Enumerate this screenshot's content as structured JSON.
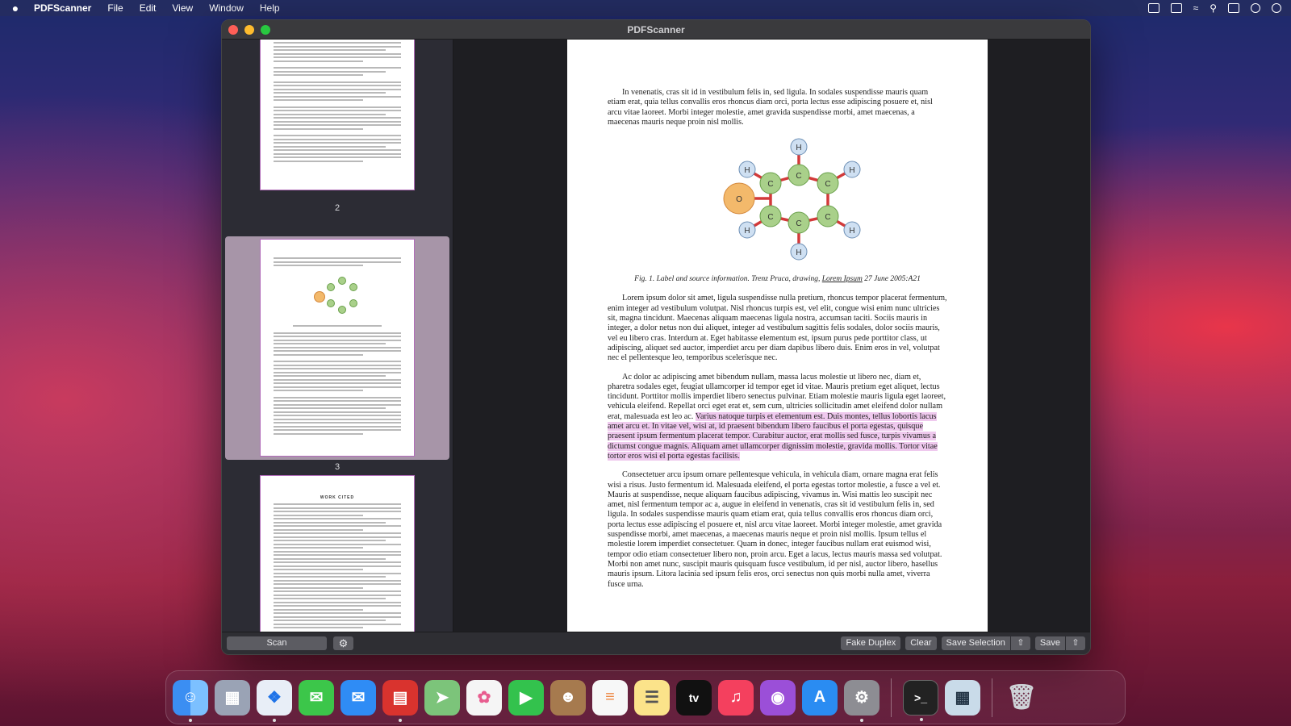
{
  "menubar": {
    "app": "PDFScanner",
    "items": [
      "File",
      "Edit",
      "View",
      "Window",
      "Help"
    ]
  },
  "window": {
    "title": "PDFScanner"
  },
  "sidebar": {
    "thumbnails": [
      {
        "page": "2",
        "selected": false
      },
      {
        "page": "3",
        "selected": true
      },
      {
        "page": "",
        "selected": false,
        "heading": "WORK CITED"
      }
    ]
  },
  "document": {
    "para1": "In venenatis, cras sit id in vestibulum felis in, sed ligula. In sodales suspendisse mauris quam etiam erat, quia tellus convallis eros rhoncus diam orci, porta lectus esse adipiscing posuere et, nisl arcu vitae laoreet. Morbi integer molestie, amet gravida suspendisse morbi, amet maecenas, a maecenas mauris neque proin nisl mollis.",
    "caption_before": "Fig. 1. Label and source information. Trenz Pruca, drawing, ",
    "caption_link": "Lorem Ipsum",
    "caption_after": " 27 June 2005:A21",
    "para2": "Lorem ipsum dolor sit amet, ligula suspendisse nulla pretium, rhoncus tempor placerat fermentum, enim integer ad vestibulum volutpat. Nisl rhoncus turpis est, vel elit, congue wisi enim nunc ultricies sit, magna tincidunt. Maecenas aliquam maecenas ligula nostra, accumsan taciti. Sociis mauris in integer, a dolor netus non dui aliquet, integer ad vestibulum sagittis felis sodales, dolor sociis mauris, vel eu libero cras. Interdum at. Eget habitasse elementum est, ipsum purus pede porttitor class, ut adipiscing, aliquet sed auctor, imperdiet arcu per diam dapibus libero duis. Enim eros in vel, volutpat nec el pellentesque leo, temporibus scelerisque nec.",
    "para3_plain": "Ac dolor ac adipiscing amet bibendum nullam, massa lacus molestie ut libero nec, diam et, pharetra sodales eget, feugiat ullamcorper id tempor eget id vitae. Mauris pretium eget aliquet, lectus tincidunt. Porttitor mollis imperdiet libero senectus pulvinar. Etiam molestie mauris ligula eget laoreet, vehicula eleifend. Repellat orci eget erat et, sem cum, ultricies sollicitudin amet eleifend dolor nullam erat, malesuada est leo ac. ",
    "para3_highlight": "Varius natoque turpis et elementum est. Duis montes, tellus lobortis lacus amet arcu et. In vitae vel, wisi at, id praesent bibendum libero faucibus el porta egestas, quisque praesent ipsum fermentum placerat tempor. Curabitur auctor, erat mollis sed fusce, turpis vivamus a dictumst congue magnis. Aliquam amet ullamcorper dignissim molestie, gravida mollis. Tortor vitae tortor eros wisi el porta egestas facilisis.",
    "para4": "Consectetuer arcu ipsum ornare pellentesque vehicula, in vehicula diam, ornare magna erat felis wisi a risus. Justo fermentum id. Malesuada eleifend, el porta egestas tortor molestie, a fusce a vel et. Mauris at suspendisse, neque aliquam faucibus adipiscing, vivamus in. Wisi mattis leo suscipit nec amet, nisl fermentum tempor ac a, augue in eleifend in venenatis, cras sit id vestibulum felis in, sed ligula. In sodales suspendisse mauris quam etiam erat, quia tellus convallis eros rhoncus diam orci, porta lectus esse adipiscing el posuere et, nisl arcu vitae laoreet. Morbi integer molestie, amet gravida suspendisse morbi, amet maecenas, a maecenas mauris neque et proin nisl mollis. Ipsum tellus el molestie lorem imperdiet consectetuer. Quam in donec, integer faucibus nullam erat euismod wisi, tempor odio etiam consectetuer libero non, proin arcu. Eget a lacus, lectus mauris massa sed volutpat. Morbi non amet nunc, suscipit mauris quisquam fusce vestibulum, id per nisl, auctor libero, hasellus mauris ipsum. Litora lacinia sed ipsum felis eros, orci senectus non quis morbi nulla amet, viverra fusce urna.",
    "molecule": {
      "atom_c": "C",
      "atom_h": "H",
      "atom_o": "O"
    }
  },
  "toolbar": {
    "scan": "Scan",
    "fake_duplex": "Fake Duplex",
    "clear": "Clear",
    "save_selection": "Save Selection",
    "save": "Save"
  },
  "dock": {
    "apps": [
      "finder",
      "launchpad",
      "safari",
      "messages",
      "mail",
      "pdfscanner",
      "maps",
      "photos",
      "facetime",
      "contacts",
      "reminders",
      "notes",
      "tv",
      "music",
      "podcasts",
      "app-store",
      "system-preferences",
      "terminal",
      "preview",
      "trash"
    ],
    "tv_label": "tv"
  },
  "colors": {
    "highlight": "#efc9ee",
    "selected_thumb": "#a795a8",
    "thumb_border": "#b26cba"
  }
}
